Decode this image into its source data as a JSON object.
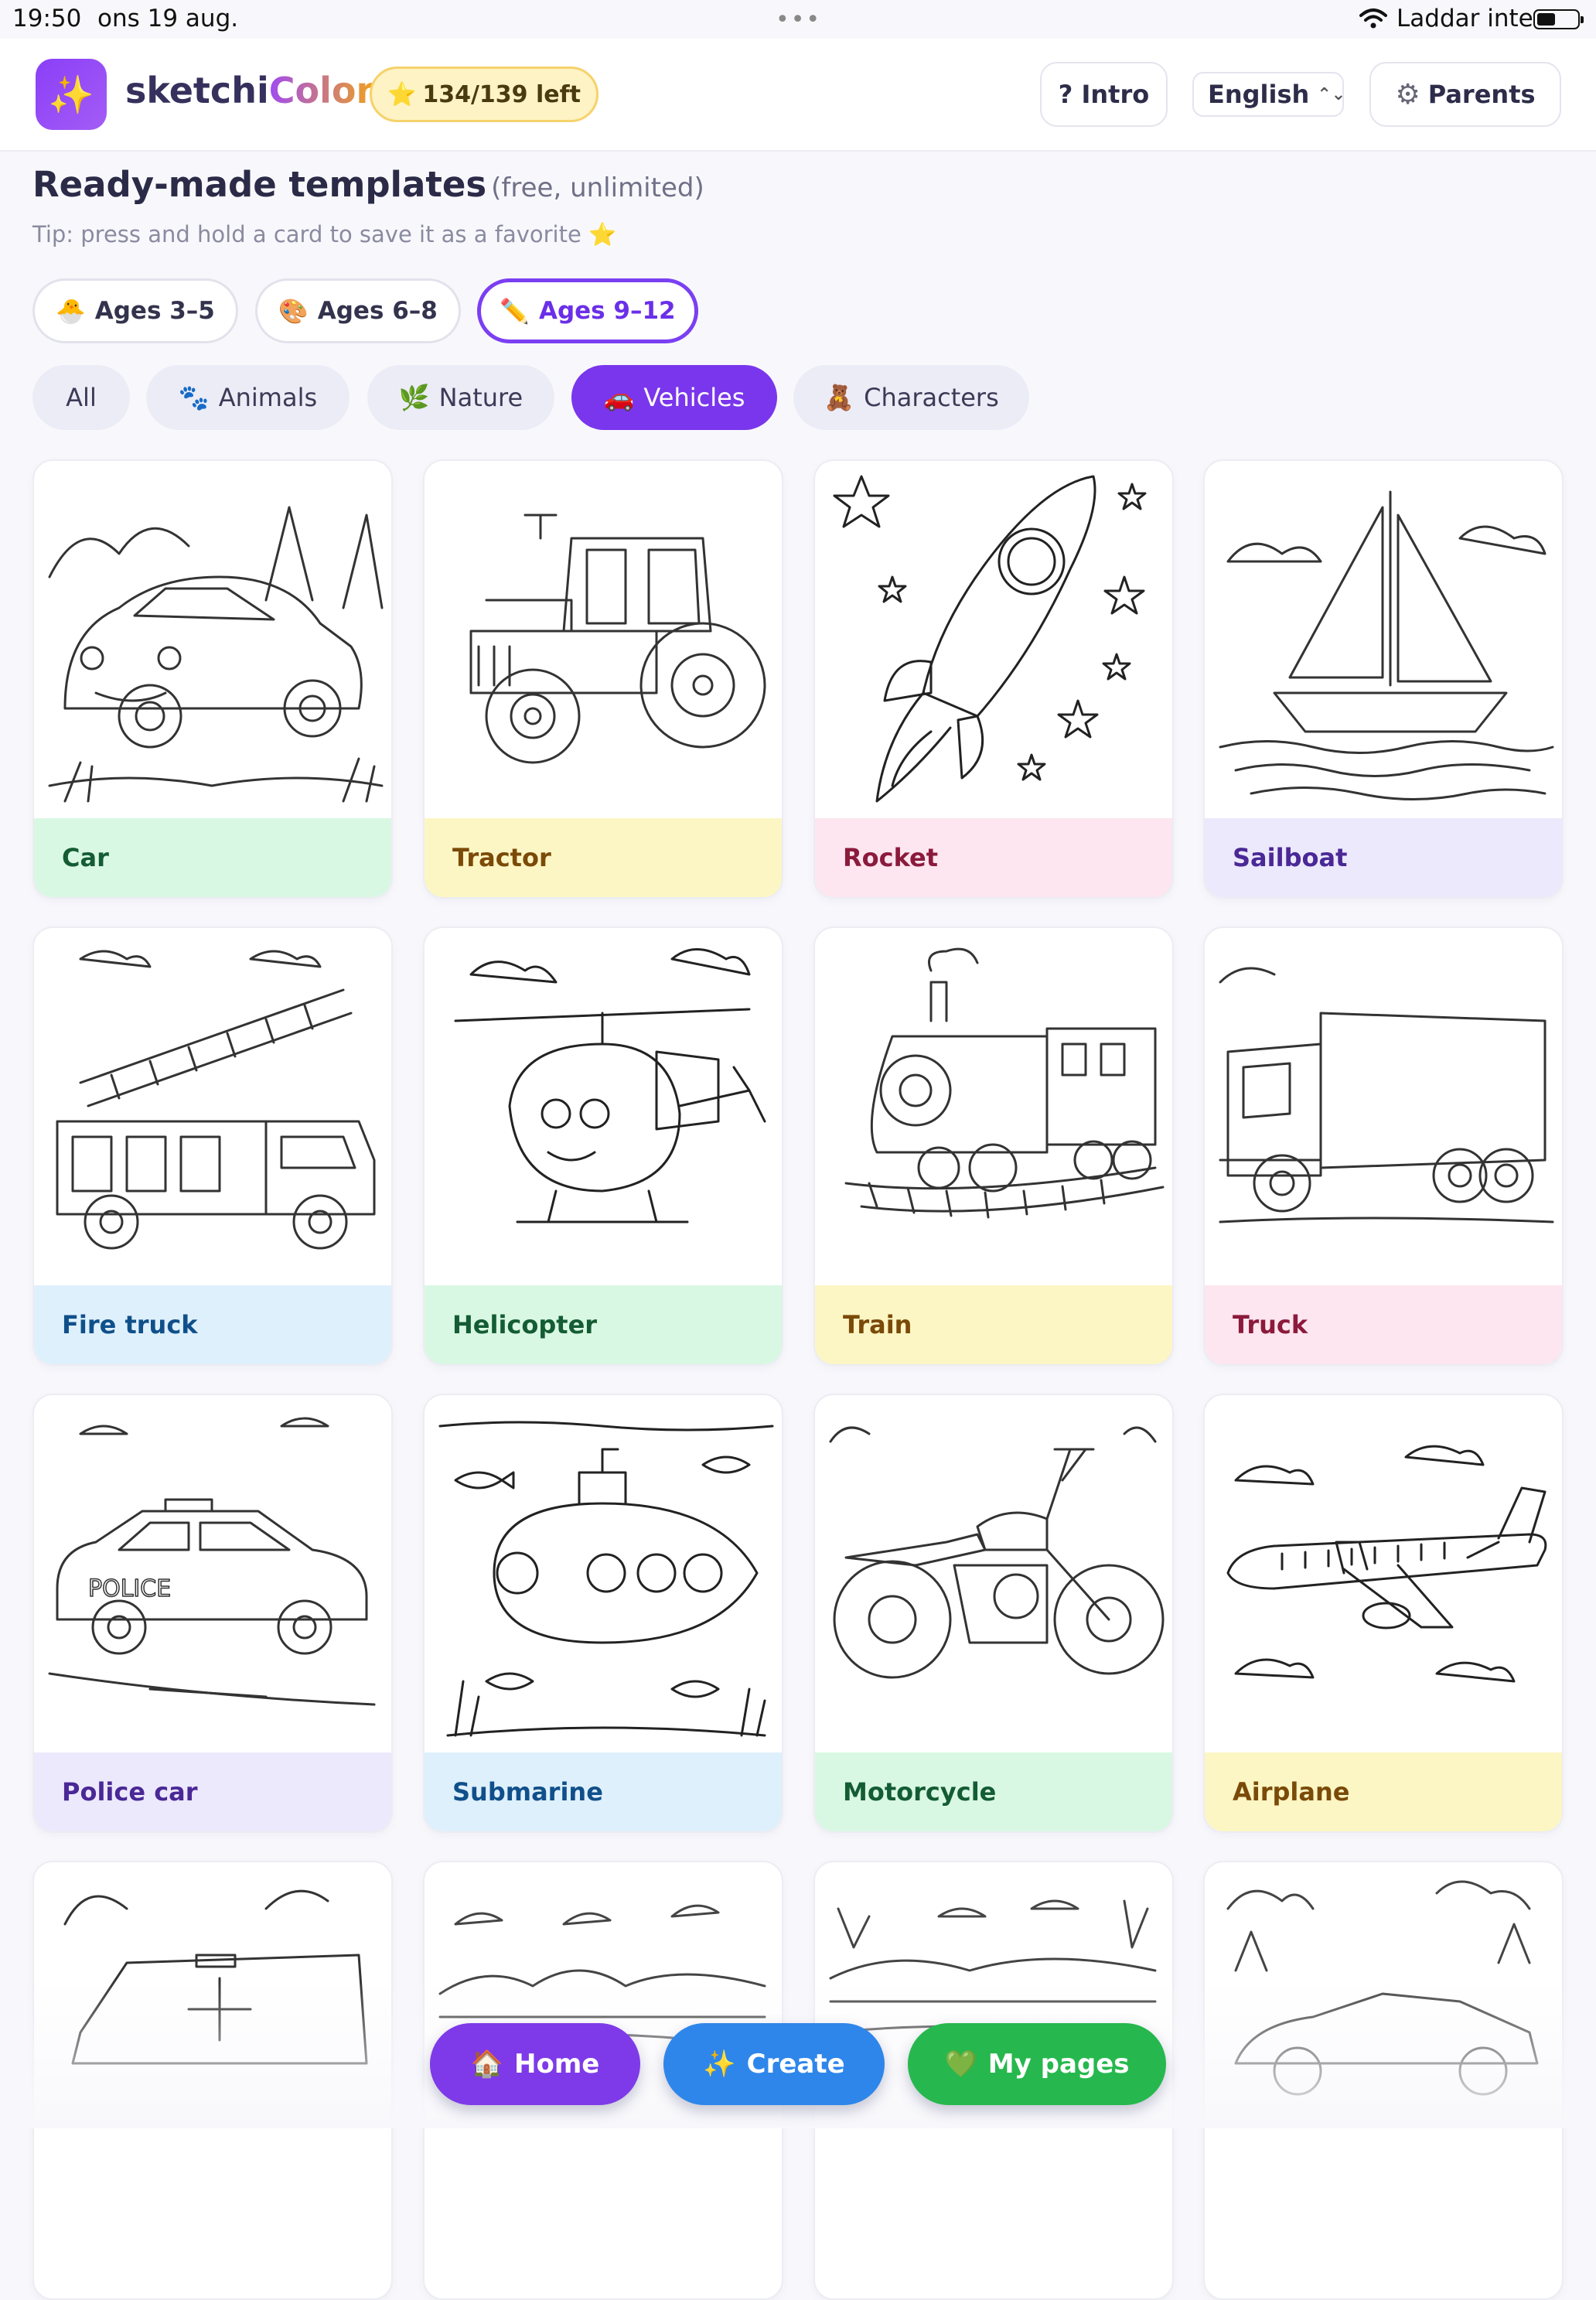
{
  "status": {
    "time": "19:50",
    "date": "ons 19 aug.",
    "charging": "Laddar inte",
    "battery_level": 0.45
  },
  "header": {
    "app_name_part1": "sketchi",
    "app_name_part2": "Color",
    "credits": "134/139 left",
    "intro": "? Intro",
    "language": "English",
    "parents": "Parents",
    "logo_icon": "sparkles-icon",
    "credits_icon": "star-icon",
    "parents_icon": "gear-icon"
  },
  "section": {
    "title": "Ready-made templates",
    "subtitle": "(free, unlimited)",
    "tip": "Tip: press and hold a card to save it as a favorite"
  },
  "age_filters": [
    {
      "label": "Ages 3–5",
      "icon": "🐣",
      "active": false
    },
    {
      "label": "Ages 6–8",
      "icon": "🎨",
      "active": false
    },
    {
      "label": "Ages 9–12",
      "icon": "✏️",
      "active": true
    }
  ],
  "categories": [
    {
      "label": "All",
      "icon": "",
      "active": false
    },
    {
      "label": "Animals",
      "icon": "🐾",
      "active": false
    },
    {
      "label": "Nature",
      "icon": "🌿",
      "active": false
    },
    {
      "label": "Vehicles",
      "icon": "🚗",
      "active": true
    },
    {
      "label": "Characters",
      "icon": "🧸",
      "active": false
    }
  ],
  "templates": [
    {
      "label": "Car",
      "color": "green",
      "icon": "car-drawing"
    },
    {
      "label": "Tractor",
      "color": "yellow",
      "icon": "tractor-drawing"
    },
    {
      "label": "Rocket",
      "color": "pink",
      "icon": "rocket-drawing"
    },
    {
      "label": "Sailboat",
      "color": "lavender",
      "icon": "sailboat-drawing"
    },
    {
      "label": "Fire truck",
      "color": "blue",
      "icon": "fire-truck-drawing"
    },
    {
      "label": "Helicopter",
      "color": "green",
      "icon": "helicopter-drawing"
    },
    {
      "label": "Train",
      "color": "yellow",
      "icon": "train-drawing"
    },
    {
      "label": "Truck",
      "color": "pink",
      "icon": "truck-drawing"
    },
    {
      "label": "Police car",
      "color": "lavender",
      "icon": "police-car-drawing"
    },
    {
      "label": "Submarine",
      "color": "blue",
      "icon": "submarine-drawing"
    },
    {
      "label": "Motorcycle",
      "color": "green",
      "icon": "motorcycle-drawing"
    },
    {
      "label": "Airplane",
      "color": "yellow",
      "icon": "airplane-drawing"
    }
  ],
  "bottom_nav": {
    "home": "Home",
    "home_icon": "🏠",
    "create": "Create",
    "create_icon": "✨",
    "pages": "My pages",
    "pages_icon": "💚"
  },
  "colors": {
    "accent": "#7a36ec",
    "create": "#2e86ea",
    "pages": "#26b84e",
    "credits_bg": "#fdf3c4"
  }
}
